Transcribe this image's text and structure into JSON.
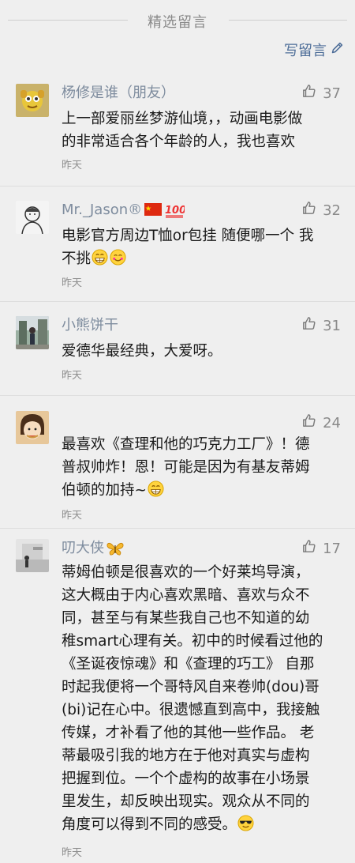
{
  "header": {
    "title": "精选留言",
    "write_label": "写留言"
  },
  "comments": [
    {
      "nickname": "杨修是谁（朋友）",
      "likes": "37",
      "lines": [
        "上一部爱丽丝梦游仙境，，动画电影做",
        "的非常适合各个年龄的人，我也喜欢"
      ],
      "time": "昨天"
    },
    {
      "nickname": "Mr._Jason®",
      "likes": "32",
      "line1": "电影官方周边T恤or包挂  随便哪一个 我",
      "line2": "不挑",
      "time": "昨天"
    },
    {
      "nickname": "小熊饼干",
      "likes": "31",
      "lines": [
        "爱德华最经典，大爱呀。"
      ],
      "time": "昨天"
    },
    {
      "nickname": "",
      "likes": "24",
      "line1": "最喜欢《查理和他的巧克力工厂》！德",
      "line2": "普叔帅炸！恩！可能是因为有基友蒂姆",
      "line3": "伯顿的加持~",
      "time": "昨天"
    },
    {
      "nickname": "叨大侠",
      "likes": "17",
      "lines": [
        "蒂姆伯顿是很喜欢的一个好莱坞导演，",
        "这大概由于内心喜欢黑暗、喜欢与众不",
        "同，甚至与有某些我自己也不知道的幼",
        "稚smart心理有关。初中的时候看过他的",
        "《圣诞夜惊魂》和《查理的巧工》 自那",
        "时起我便将一个哥特风自来卷帅(dou)哥",
        "(bi)记在心中。很遗憾直到高中，我接触",
        "传媒，才补看了他的其他一些作品。 老",
        "蒂最吸引我的地方在于他对真实与虚构",
        "把握到位。一个个虚构的故事在小场景",
        "里发生，却反映出现实。观众从不同的"
      ],
      "last_line": "角度可以得到不同的感受。",
      "time": "昨天"
    }
  ],
  "colors": {
    "nickname": "#7e8c9e",
    "link": "#4d6d98",
    "meta": "#8a8a8a"
  }
}
